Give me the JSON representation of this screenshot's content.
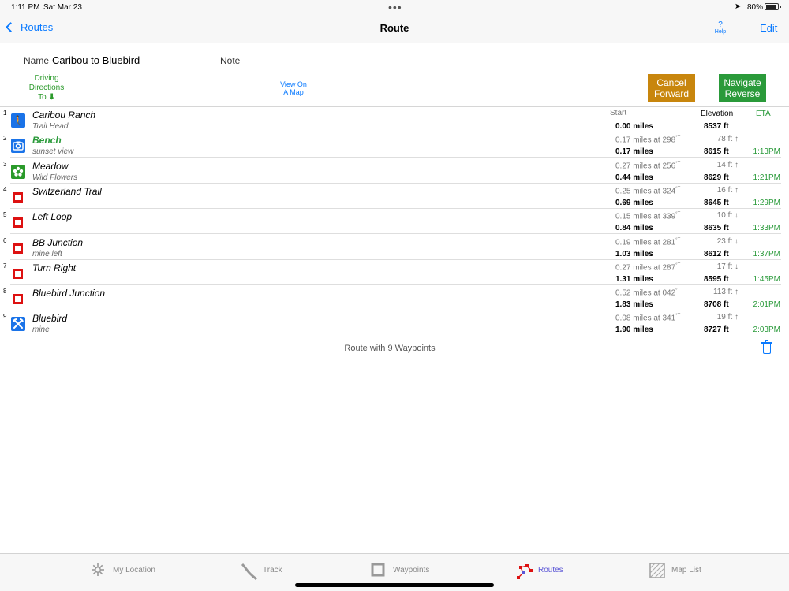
{
  "status": {
    "time": "1:11 PM",
    "date": "Sat Mar 23",
    "battery": "80%"
  },
  "nav": {
    "back_label": "Routes",
    "title": "Route",
    "help_q": "?",
    "help_label": "Help",
    "edit_label": "Edit"
  },
  "route": {
    "name_label": "Name",
    "name_value": "Caribou to Bluebird",
    "note_label": "Note",
    "driving": [
      "Driving",
      "Directions",
      "To"
    ],
    "driving_arrow": "⬇",
    "view_map": [
      "View On",
      "A Map"
    ],
    "cancel_button": [
      "Cancel",
      "Forward"
    ],
    "navigate_button": [
      "Navigate",
      "Reverse"
    ]
  },
  "columns": {
    "start": "Start",
    "elevation": "Elevation",
    "eta": "ETA"
  },
  "waypoints": [
    {
      "num": "1",
      "icon": "hiker-icon",
      "title": "Caribou Ranch",
      "sub": "Trail Head",
      "leg": "",
      "bearing": "",
      "dist": "0.00 miles",
      "delta": "",
      "elev": "8537 ft",
      "eta": ""
    },
    {
      "num": "2",
      "icon": "camera-icon",
      "title": "Bench",
      "sub": "sunset view",
      "leg": "0.17 miles at 298",
      "bearing": "°T",
      "dist": "0.17 miles",
      "delta": "78 ft ↑",
      "elev": "8615 ft",
      "eta": "1:13PM"
    },
    {
      "num": "3",
      "icon": "flower-icon",
      "title": "Meadow",
      "sub": "Wild Flowers",
      "leg": "0.27 miles at 256",
      "bearing": "°T",
      "dist": "0.44 miles",
      "delta": "14 ft ↑",
      "elev": "8629 ft",
      "eta": "1:21PM"
    },
    {
      "num": "4",
      "icon": "waypoint-square-icon",
      "title": "Switzerland Trail",
      "sub": "",
      "leg": "0.25 miles at 324",
      "bearing": "°T",
      "dist": "0.69 miles",
      "delta": "16 ft ↑",
      "elev": "8645 ft",
      "eta": "1:29PM"
    },
    {
      "num": "5",
      "icon": "waypoint-square-icon",
      "title": "Left Loop",
      "sub": "",
      "leg": "0.15 miles at 339",
      "bearing": "°T",
      "dist": "0.84 miles",
      "delta": "10 ft ↓",
      "elev": "8635 ft",
      "eta": "1:33PM"
    },
    {
      "num": "6",
      "icon": "waypoint-square-icon",
      "title": "BB Junction",
      "sub": "mine left",
      "leg": "0.19 miles at 281",
      "bearing": "°T",
      "dist": "1.03 miles",
      "delta": "23 ft ↓",
      "elev": "8612 ft",
      "eta": "1:37PM"
    },
    {
      "num": "7",
      "icon": "waypoint-square-icon",
      "title": "Turn Right",
      "sub": "",
      "leg": "0.27 miles at 287",
      "bearing": "°T",
      "dist": "1.31 miles",
      "delta": "17 ft ↓",
      "elev": "8595 ft",
      "eta": "1:45PM"
    },
    {
      "num": "8",
      "icon": "waypoint-square-icon",
      "title": "Bluebird Junction",
      "sub": "",
      "leg": "0.52 miles at 042",
      "bearing": "°T",
      "dist": "1.83 miles",
      "delta": "113 ft ↑",
      "elev": "8708 ft",
      "eta": "2:01PM"
    },
    {
      "num": "9",
      "icon": "mine-icon",
      "title": "Bluebird",
      "sub": "mine",
      "leg": "0.08 miles at 341",
      "bearing": "°T",
      "dist": "1.90 miles",
      "delta": "19 ft ↑",
      "elev": "8727 ft",
      "eta": "2:03PM"
    }
  ],
  "footer": {
    "summary": "Route with 9 Waypoints"
  },
  "tabs": [
    {
      "label": "My Location",
      "icon": "sun-location-icon",
      "active": false
    },
    {
      "label": "Track",
      "icon": "track-icon",
      "active": false
    },
    {
      "label": "Waypoints",
      "icon": "waypoint-icon",
      "active": false
    },
    {
      "label": "Routes",
      "icon": "route-icon",
      "active": true
    },
    {
      "label": "Map List",
      "icon": "map-icon",
      "active": false
    }
  ],
  "colors": {
    "accent": "#0a7aff",
    "green": "#2a9a3a",
    "orange": "#c8860d",
    "active_tab": "#5a55d6",
    "waypoint_red": "#dd1111"
  }
}
